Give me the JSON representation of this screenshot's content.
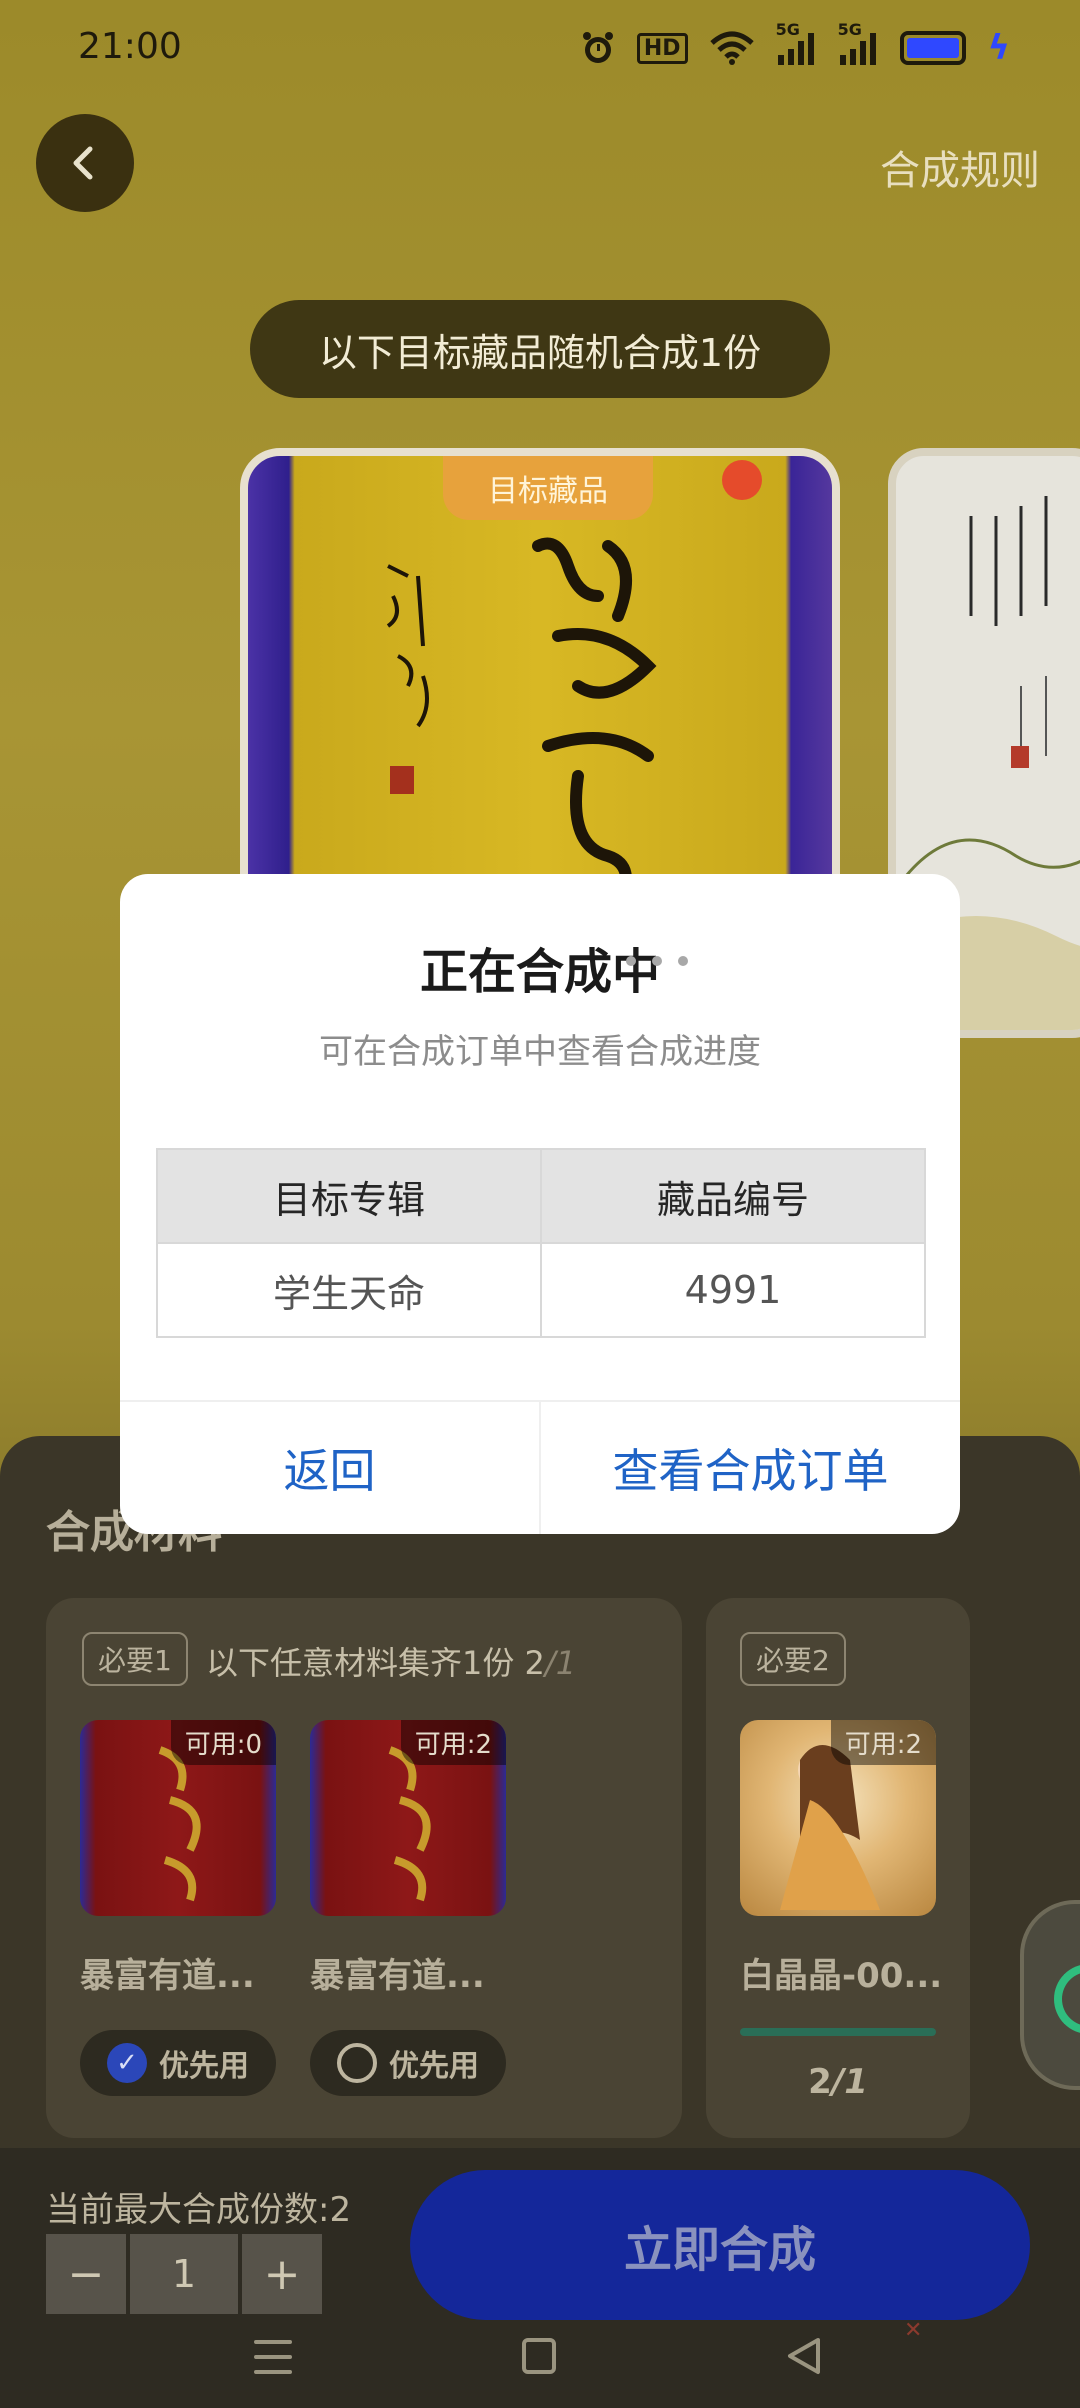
{
  "status_bar": {
    "time": "21:00",
    "icons": [
      "alarm-icon",
      "hd-icon",
      "wifi-icon",
      "signal-5g-icon",
      "signal-5g-icon",
      "battery-icon",
      "charging-icon"
    ],
    "hd_label": "HD",
    "net1": "5G",
    "net2": "5G"
  },
  "header": {
    "back_icon": "chevron-left-icon",
    "rules_label": "合成规则"
  },
  "target": {
    "pill_text": "以下目标藏品随机合成1份",
    "card_tag": "目标藏品"
  },
  "materials": {
    "title": "合成材料",
    "group1": {
      "badge": "必要1",
      "description": "以下任意材料集齐1份 2",
      "required": "/1",
      "items": [
        {
          "available": "可用:0",
          "name": "暴富有道...",
          "priority_label": "优先用",
          "priority_checked": true
        },
        {
          "available": "可用:2",
          "name": "暴富有道...",
          "priority_label": "优先用",
          "priority_checked": false
        }
      ]
    },
    "group2": {
      "badge": "必要2",
      "available": "可用:2",
      "name": "白晶晶-00...",
      "count": "2",
      "required": "/1"
    }
  },
  "bottom": {
    "max_label": "当前最大合成份数:2",
    "minus": "−",
    "quantity": "1",
    "plus": "+",
    "synth_button": "立即合成"
  },
  "dialog": {
    "title": "正在合成中",
    "subtitle": "可在合成订单中查看合成进度",
    "table_headers": [
      "目标专辑",
      "藏品编号"
    ],
    "table_row": [
      "学生天命",
      "4991"
    ],
    "back_button": "返回",
    "view_orders_button": "查看合成订单"
  },
  "colors": {
    "accent_blue": "#1f63c6",
    "synth_button": "#14279a",
    "progress_green": "#2a6e57"
  }
}
